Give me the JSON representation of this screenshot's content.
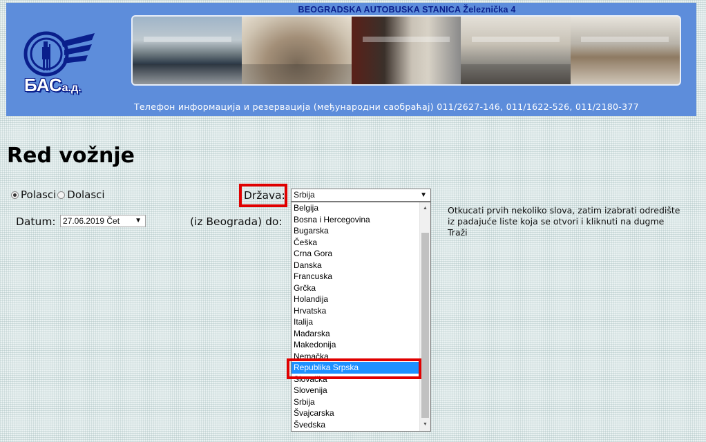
{
  "header": {
    "title": "BEOGRADSKA AUTOBUSKA STANICA Železnička 4",
    "logo_text_main": "БАС",
    "logo_text_suffix": "а.д.",
    "phone_line": "Телефон информација и резервација (међународни саобраћај) 011/2627-146, 011/1622-526, 011/2180-377",
    "colors": {
      "header_bg": "#5d8ddb",
      "title": "#0a1f8c"
    }
  },
  "main": {
    "page_title": "Red vožnje",
    "radio": {
      "options": [
        {
          "label": "Polasci",
          "checked": true
        },
        {
          "label": "Dolasci",
          "checked": false
        }
      ]
    },
    "datum": {
      "label": "Datum:",
      "value": "27.06.2019 Čet"
    },
    "drzava": {
      "label": "Država:",
      "selected": "Srbija"
    },
    "destination": {
      "label": "(iz Beograda) do:"
    },
    "dropdown": {
      "options": [
        "Belgija",
        "Bosna i Hercegovina",
        "Bugarska",
        "Češka",
        "Crna Gora",
        "Danska",
        "Francuska",
        "Grčka",
        "Holandija",
        "Hrvatska",
        "Italija",
        "Mađarska",
        "Makedonija",
        "Nemačka",
        "Republika Srpska",
        "Slovačka",
        "Slovenija",
        "Srbija",
        "Švajcarska",
        "Švedska"
      ],
      "highlighted": "Republika Srpska"
    },
    "help_text": "Otkucati prvih nekoliko slova, zatim izabrati odredište iz padajuće liste koja se otvori i kliknuti na dugme Traži"
  }
}
